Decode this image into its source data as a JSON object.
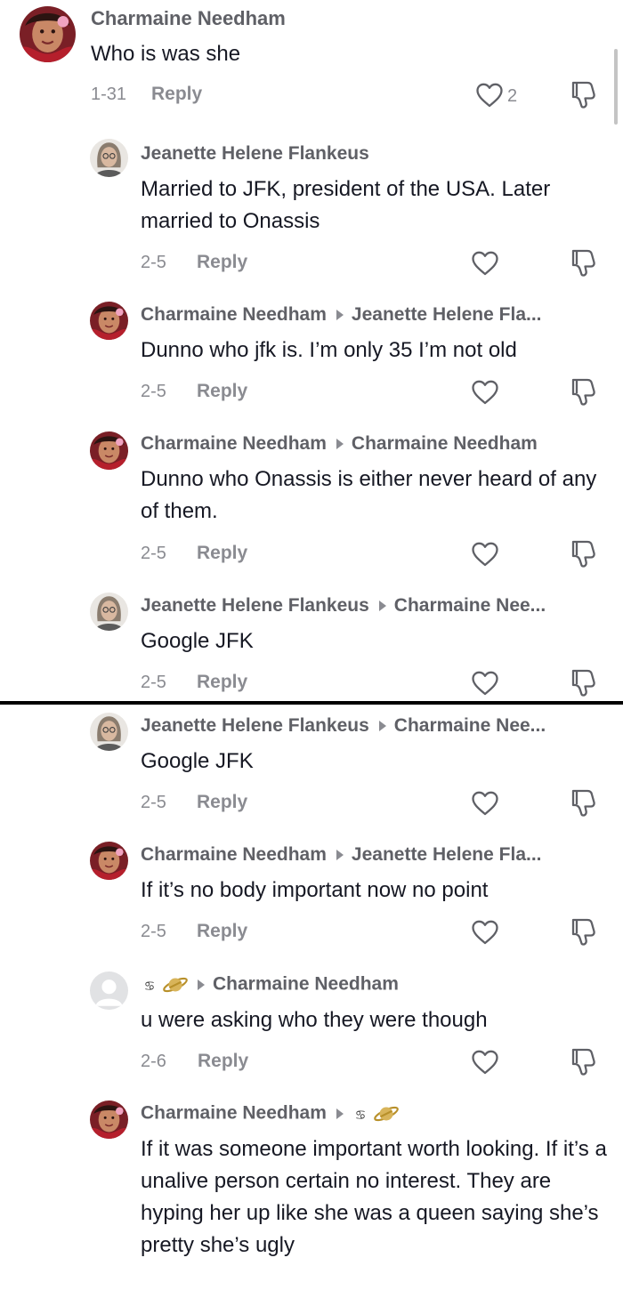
{
  "colors": {
    "text": "#161823",
    "muted": "#8a8b91",
    "name": "#5f6066",
    "divider": "#000000"
  },
  "icons": {
    "like": "heart-outline-icon",
    "dislike": "thumbs-down-outline-icon"
  },
  "reply_label": "Reply",
  "comments": [
    {
      "author": "Charmaine Needham",
      "reply_to": "",
      "text": "Who is was she",
      "date": "1-31",
      "likes": "2"
    },
    {
      "author": "Jeanette Helene Flankeus",
      "reply_to": "",
      "text": "Married to JFK, president of the USA. Later married to Onassis",
      "date": "2-5",
      "likes": ""
    },
    {
      "author": "Charmaine Needham",
      "reply_to": "Jeanette Helene Fla...",
      "text": "Dunno who jfk is. I’m only 35 I’m not old",
      "date": "2-5",
      "likes": ""
    },
    {
      "author": "Charmaine Needham",
      "reply_to": "Charmaine Needham",
      "text": "Dunno who Onassis is either never heard of any of them.",
      "date": "2-5",
      "likes": ""
    },
    {
      "author": "Jeanette Helene Flankeus",
      "reply_to": "Charmaine Nee...",
      "text": "Google JFK",
      "date": "2-5",
      "likes": ""
    },
    {
      "author": "Jeanette Helene Flankeus",
      "reply_to": "Charmaine Nee...",
      "text": "Google JFK",
      "date": "2-5",
      "likes": ""
    },
    {
      "author": "Charmaine Needham",
      "reply_to": "Jeanette Helene Fla...",
      "text": "If it’s no body important now no point",
      "date": "2-5",
      "likes": ""
    },
    {
      "author": "♋🪐",
      "reply_to": "Charmaine Needham",
      "text": "u were asking who they were though",
      "date": "2-6",
      "likes": ""
    },
    {
      "author": "Charmaine Needham",
      "reply_to": "♋🪐",
      "text": "If it was someone important worth looking. If it’s a unalive person certain no interest. They are hyping her up like she was a queen saying she’s pretty she’s ugly",
      "date": "",
      "likes": ""
    }
  ]
}
